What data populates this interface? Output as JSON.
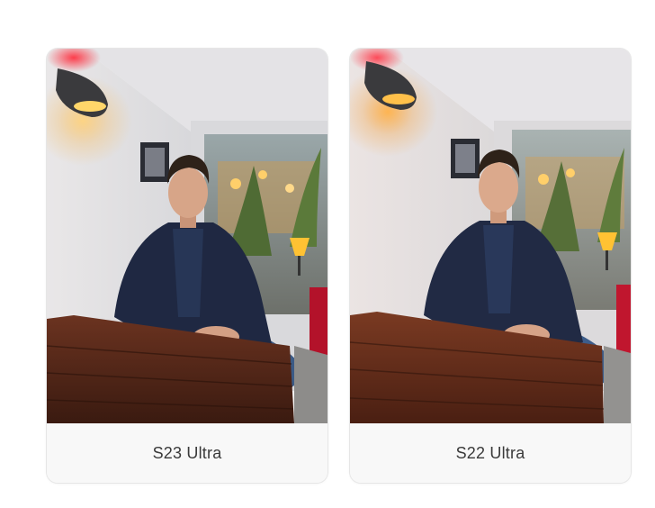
{
  "cards": [
    {
      "label": "S23 Ultra",
      "photo_icon": "portrait-photo"
    },
    {
      "label": "S22 Ultra",
      "photo_icon": "portrait-photo"
    }
  ],
  "colors": {
    "background": "#ffffff",
    "card_bg": "#f8f8f8",
    "caption_text": "#3a3a3a",
    "lamp_glow": "#ffb347",
    "neon_red": "#ff2a3a",
    "table_wood": "#5a2a1a",
    "jacket": "#1d2740"
  }
}
